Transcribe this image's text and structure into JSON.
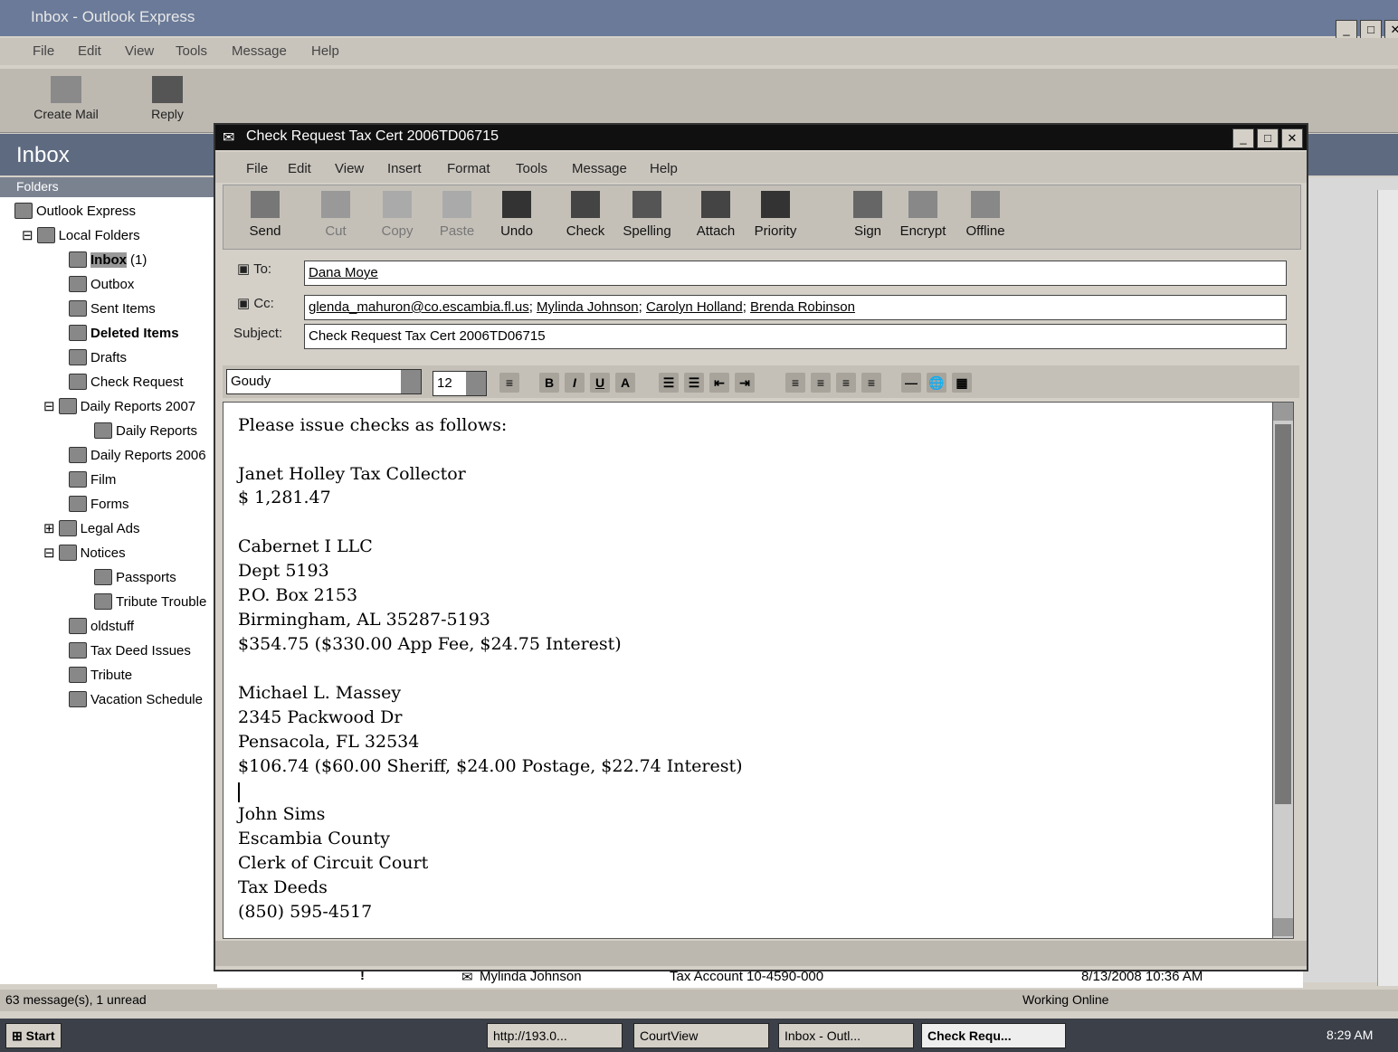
{
  "outlook": {
    "title": "Inbox - Outlook Express",
    "menu": [
      "File",
      "Edit",
      "View",
      "Tools",
      "Message",
      "Help"
    ],
    "toolbar": [
      "Create Mail",
      "Reply"
    ],
    "view_title": "Inbox",
    "folders_header": "Folders",
    "tree": {
      "root": "Outlook Express",
      "local": "Local Folders",
      "inbox": "Inbox",
      "inbox_count": "(1)",
      "outbox": "Outbox",
      "sent": "Sent Items",
      "deleted": "Deleted Items",
      "drafts": "Drafts",
      "check": "Check Request",
      "daily2007": "Daily Reports 2007",
      "daily": "Daily Reports",
      "daily2006": "Daily Reports 2006",
      "film": "Film",
      "forms": "Forms",
      "legal": "Legal Ads",
      "notices": "Notices",
      "passports": "Passports",
      "tribute_trouble": "Tribute Trouble",
      "oldstuff": "oldstuff",
      "taxdeed": "Tax Deed Issues",
      "tribute": "Tribute",
      "vacation": "Vacation Schedule"
    },
    "message_row": {
      "from": "Mylinda Johnson",
      "subject": "Tax Account 10-4590-000",
      "received": "8/13/2008 10:36 AM"
    },
    "status": {
      "count": "63 message(s), 1 unread",
      "online": "Working Online"
    }
  },
  "compose": {
    "title": "Check Request Tax Cert 2006TD06715",
    "menu": [
      "File",
      "Edit",
      "View",
      "Insert",
      "Format",
      "Tools",
      "Message",
      "Help"
    ],
    "toolbar": [
      "Send",
      "Cut",
      "Copy",
      "Paste",
      "Undo",
      "Check",
      "Spelling",
      "Attach",
      "Priority",
      "Sign",
      "Encrypt",
      "Offline"
    ],
    "to_label": "To:",
    "to": "Dana Moye",
    "cc_label": "Cc:",
    "cc": [
      "glenda_mahuron@co.escambia.fl.us",
      "Mylinda Johnson",
      "Carolyn Holland",
      "Brenda Robinson"
    ],
    "subject_label": "Subject:",
    "subject": "Check Request Tax Cert 2006TD06715",
    "font": "Goudy",
    "size": "12",
    "body": [
      "Please issue checks as follows:",
      "Janet Holley Tax Collector",
      "$ 1,281.47",
      "Cabernet I LLC",
      "Dept 5193",
      "P.O. Box 2153",
      "Birmingham, AL 35287-5193",
      "$354.75 ($330.00 App Fee, $24.75 Interest)",
      "Michael L. Massey",
      "2345 Packwood Dr",
      "Pensacola, FL 32534",
      "$106.74 ($60.00 Sheriff, $24.00 Postage, $22.74 Interest)",
      "John Sims",
      "Escambia County",
      "Clerk of Circuit Court",
      "Tax Deeds",
      "(850) 595-4517"
    ]
  },
  "taskbar": {
    "start": "Start",
    "buttons": [
      "http://193.0...",
      "CourtView",
      "Inbox - Outl...",
      "Check Requ..."
    ],
    "clock": "8:29 AM"
  }
}
